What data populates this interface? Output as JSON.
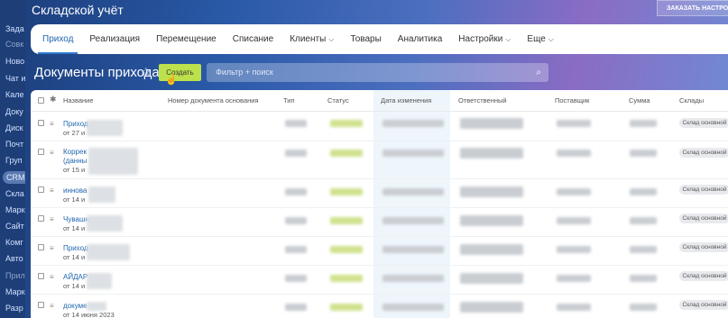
{
  "sidebar": {
    "items": [
      "Зада",
      "Совк",
      "Ново",
      "Чат и",
      "Кале",
      "Доку",
      "Диск",
      "Почт",
      "Груп"
    ],
    "crm": "CRM",
    "items_bottom": [
      "Скла",
      "Марк",
      "Сайт",
      "Комг",
      "Авто",
      "Прил",
      "Марк",
      "Разр"
    ]
  },
  "header": {
    "app_title": "Складской учёт",
    "order_button": "ЗАКАЗАТЬ НАСТРОЙКУ"
  },
  "tabs": [
    {
      "label": "Приход",
      "active": true
    },
    {
      "label": "Реализация"
    },
    {
      "label": "Перемещение"
    },
    {
      "label": "Списание"
    },
    {
      "label": "Клиенты",
      "dropdown": true
    },
    {
      "label": "Товары"
    },
    {
      "label": "Аналитика"
    },
    {
      "label": "Настройки",
      "dropdown": true
    },
    {
      "label": "Еще",
      "dropdown": true
    }
  ],
  "page": {
    "title": "Документы прихода",
    "create_button": "Создать",
    "search_placeholder": "Фильтр + поиск"
  },
  "table": {
    "columns": [
      "Название",
      "Номер документа основания",
      "Тип",
      "Статус",
      "Дата изменения",
      "Ответственный",
      "Поставщик",
      "Сумма",
      "Склады"
    ],
    "rows": [
      {
        "name": "Приход",
        "name2": "",
        "date": "от 27 и",
        "warehouse": "Склад основной"
      },
      {
        "name": "Коррек",
        "name2": "(данны",
        "date": "от 15 и",
        "warehouse": "Склад основной"
      },
      {
        "name": "иннова",
        "name2": "",
        "date": "от 14 и",
        "warehouse": "Склад основной"
      },
      {
        "name": "Чувашн",
        "name2": "",
        "date": "от 14 и",
        "warehouse": "Склад основной"
      },
      {
        "name": "Приход",
        "name2": "",
        "date": "от 14 и",
        "warehouse": "Склад основной"
      },
      {
        "name": "АЙДАР",
        "name2": "",
        "date": "от 14 и",
        "warehouse": "Склад основной"
      },
      {
        "name": "докуме",
        "name2": "",
        "date": "от 14 июня 2023",
        "warehouse": "Склад основной"
      }
    ]
  },
  "colors": {
    "accent": "#2f7bd0",
    "create_button": "#bde14c",
    "sidebar": "#1e3e78"
  }
}
